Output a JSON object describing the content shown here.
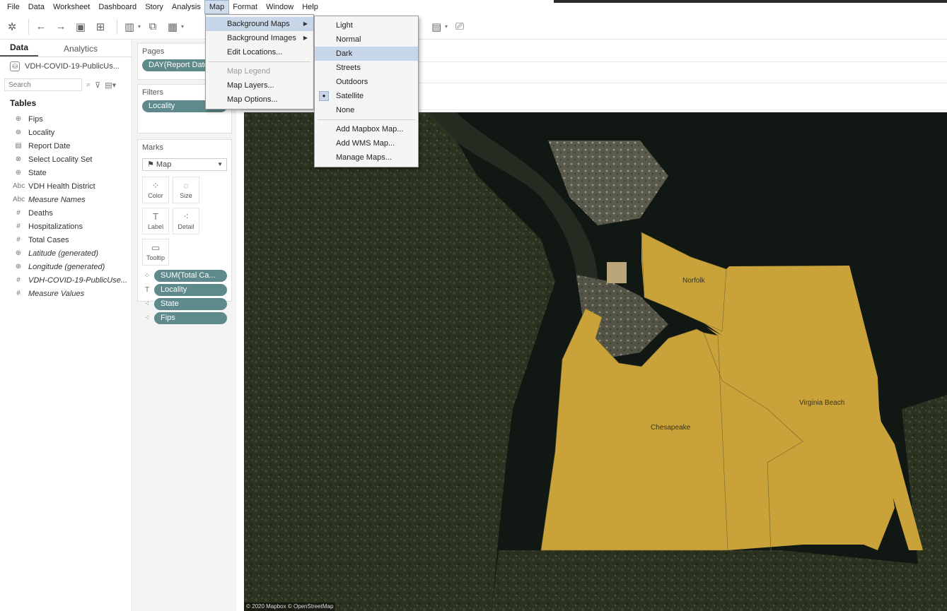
{
  "menubar": {
    "items": [
      "File",
      "Data",
      "Worksheet",
      "Dashboard",
      "Story",
      "Analysis",
      "Map",
      "Format",
      "Window",
      "Help"
    ],
    "active": "Map"
  },
  "toolbar": {
    "icons": [
      "tableau-logo-icon",
      "undo-icon",
      "redo-icon",
      "save-icon",
      "new-datasource-icon",
      "new-worksheet-icon",
      "duplicate-icon",
      "clear-sheet-icon",
      "show-cards-icon",
      "presentation-icon"
    ]
  },
  "datapane": {
    "tabs": [
      "Data",
      "Analytics"
    ],
    "datasource": "VDH-COVID-19-PublicUs...",
    "search_placeholder": "Search",
    "tables_label": "Tables",
    "fields": [
      {
        "icon": "⊕",
        "label": "Fips",
        "italic": false
      },
      {
        "icon": "⊕",
        "label": "Locality",
        "italic": false
      },
      {
        "icon": "▤",
        "label": "Report Date",
        "italic": false
      },
      {
        "icon": "⊗",
        "label": "Select Locality Set",
        "italic": false
      },
      {
        "icon": "⊕",
        "label": "State",
        "italic": false
      },
      {
        "icon": "Abc",
        "label": "VDH Health District",
        "italic": false
      },
      {
        "icon": "Abc",
        "label": "Measure Names",
        "italic": true
      },
      {
        "icon": "#",
        "label": "Deaths",
        "italic": false
      },
      {
        "icon": "#",
        "label": "Hospitalizations",
        "italic": false
      },
      {
        "icon": "#",
        "label": "Total Cases",
        "italic": false
      },
      {
        "icon": "⊕",
        "label": "Latitude (generated)",
        "italic": true
      },
      {
        "icon": "⊕",
        "label": "Longitude (generated)",
        "italic": true
      },
      {
        "icon": "#",
        "label": "VDH-COVID-19-PublicUse...",
        "italic": true
      },
      {
        "icon": "#",
        "label": "Measure Values",
        "italic": true
      }
    ]
  },
  "shelves": {
    "pages_title": "Pages",
    "pages_pill": "DAY(Report Date)",
    "filters_title": "Filters",
    "filters_pill": "Locality",
    "marks_title": "Marks",
    "marks_type": "Map",
    "mark_buttons": [
      {
        "icon": "⁘",
        "label": "Color"
      },
      {
        "icon": "◌",
        "label": "Size"
      },
      {
        "icon": "T",
        "label": "Label"
      },
      {
        "icon": "⁖",
        "label": "Detail"
      },
      {
        "icon": "▭",
        "label": "Tooltip"
      }
    ],
    "mark_pills": [
      {
        "icon": "⁘",
        "label": "SUM(Total Ca..."
      },
      {
        "icon": "T",
        "label": "Locality"
      },
      {
        "icon": "⁖",
        "label": "State"
      },
      {
        "icon": "⁖",
        "label": "Fips"
      }
    ]
  },
  "map_menu": {
    "items": [
      {
        "label": "Background Maps",
        "submenu": true,
        "disabled": false,
        "highlight": true
      },
      {
        "label": "Background Images",
        "submenu": true,
        "disabled": false,
        "highlight": false
      },
      {
        "label": "Edit Locations...",
        "submenu": false,
        "disabled": false,
        "highlight": false
      },
      {
        "sep": true
      },
      {
        "label": "Map Legend",
        "submenu": false,
        "disabled": true,
        "highlight": false
      },
      {
        "label": "Map Layers...",
        "submenu": false,
        "disabled": false,
        "highlight": false
      },
      {
        "label": "Map Options...",
        "submenu": false,
        "disabled": false,
        "highlight": false
      }
    ]
  },
  "background_maps_menu": {
    "items": [
      {
        "label": "Light",
        "checked": false,
        "highlight": false
      },
      {
        "label": "Normal",
        "checked": false,
        "highlight": false
      },
      {
        "label": "Dark",
        "checked": false,
        "highlight": true
      },
      {
        "label": "Streets",
        "checked": false,
        "highlight": false
      },
      {
        "label": "Outdoors",
        "checked": false,
        "highlight": false
      },
      {
        "label": "Satellite",
        "checked": true,
        "highlight": false
      },
      {
        "label": "None",
        "checked": false,
        "highlight": false
      },
      {
        "sep": true
      },
      {
        "label": "Add Mapbox Map...",
        "checked": false,
        "highlight": false
      },
      {
        "label": "Add WMS Map...",
        "checked": false,
        "highlight": false
      },
      {
        "label": "Manage Maps...",
        "checked": false,
        "highlight": false
      }
    ]
  },
  "map": {
    "regions": [
      "Norfolk",
      "Virginia Beach",
      "Chesapeake"
    ],
    "region_color": "#c9a33a",
    "attribution": "© 2020 Mapbox © OpenStreetMap"
  }
}
